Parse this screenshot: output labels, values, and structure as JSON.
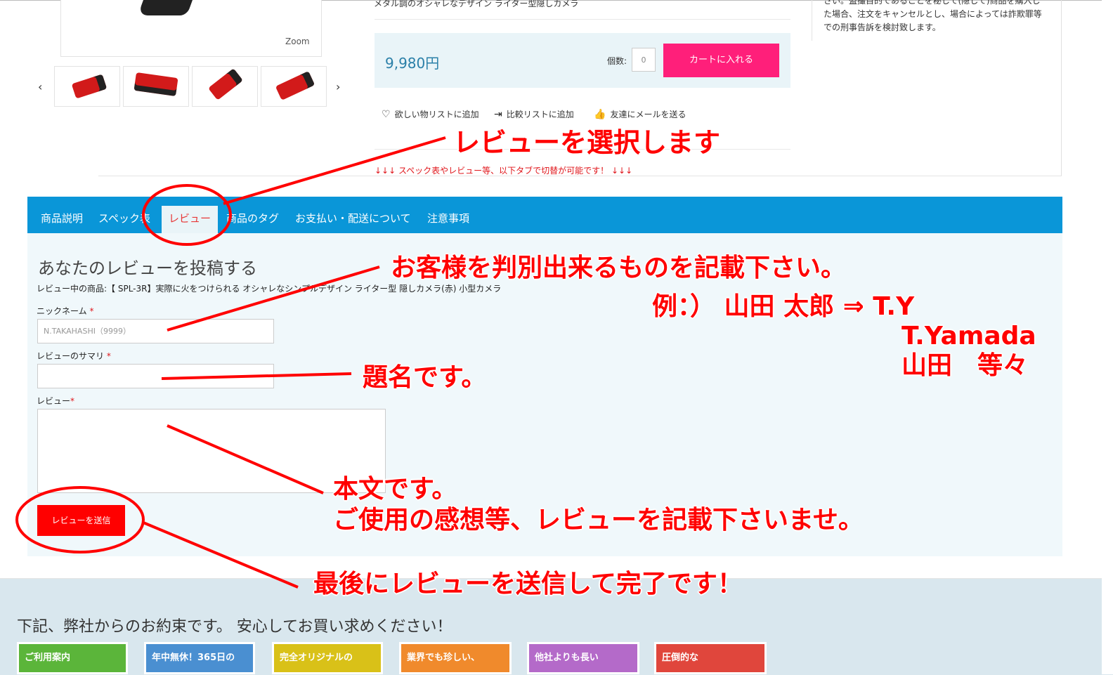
{
  "gallery": {
    "zoom_label": "Zoom",
    "prev_arrow": "‹",
    "next_arrow": "›"
  },
  "product": {
    "name": "メタル調のオシャレなデザイン ライター型隠しカメラ",
    "price": "9,980円",
    "quantity_label": "個数:",
    "quantity_value": "0",
    "add_to_cart": "カートに入れる",
    "wishlist": "欲しい物リストに追加",
    "compare": "比較リストに追加",
    "email_friend": "友達にメールを送る",
    "tab_hint": "↓↓↓ スペック表やレビュー等、以下タブで切替が可能です！ ↓↓↓"
  },
  "notice": {
    "text": "さい。盗撮目的であることを秘して(隠して)商品を購入した場合、注文をキャンセルとし、場合によっては詐欺罪等での刑事告訴を検討致します。"
  },
  "tabs": [
    {
      "label": "商品説明"
    },
    {
      "label": "スペック表"
    },
    {
      "label": "レビュー"
    },
    {
      "label": "商品のタグ"
    },
    {
      "label": "お支払い・配送について"
    },
    {
      "label": "注意事項"
    }
  ],
  "review_form": {
    "title": "あなたのレビューを投稿する",
    "product_line": "レビュー中の商品:【 SPL-3R】実際に火をつけられる オシャレなシンプルデザイン ライター型 隠しカメラ(赤) 小型カメラ",
    "nickname_label": "ニックネーム",
    "nickname_placeholder": "N.TAKAHASHI（9999）",
    "summary_label": "レビューのサマリ",
    "review_label": "レビュー",
    "required_mark": "*",
    "submit": "レビューを送信"
  },
  "annotations": {
    "select_review": "レビューを選択します",
    "identify": "お客様を判別出来るものを記載下さい。",
    "example_line1": "例：） 山田 太郎 ⇒ T.Y",
    "example_line2": "T.Yamada",
    "example_line3": "山田　等々",
    "title_note": "題名です。",
    "body_note_1": "本文です。",
    "body_note_2": "ご使用の感想等、レビューを記載下さいませ。",
    "finish_note": "最後にレビューを送信して完了です！"
  },
  "footer": {
    "title": "下記、弊社からのお約束です。 安心してお買い求めください！",
    "promos": [
      {
        "label": "ご利用案内",
        "color": "#5bb53a"
      },
      {
        "label": "年中無休！365日の",
        "color": "#4a8fd1"
      },
      {
        "label": "完全オリジナルの",
        "color": "#d9c118"
      },
      {
        "label": "業界でも珍しい、",
        "color": "#f08a2c"
      },
      {
        "label": "他社よりも長い",
        "color": "#b46ac9"
      },
      {
        "label": "圧倒的な",
        "color": "#e0463c"
      }
    ]
  },
  "colors": {
    "tab_bar": "#0a96d8",
    "cart_button": "#ff1f7a",
    "submit_button": "#ff0000",
    "annotation": "#ff0000",
    "price": "#2a7fa8"
  }
}
